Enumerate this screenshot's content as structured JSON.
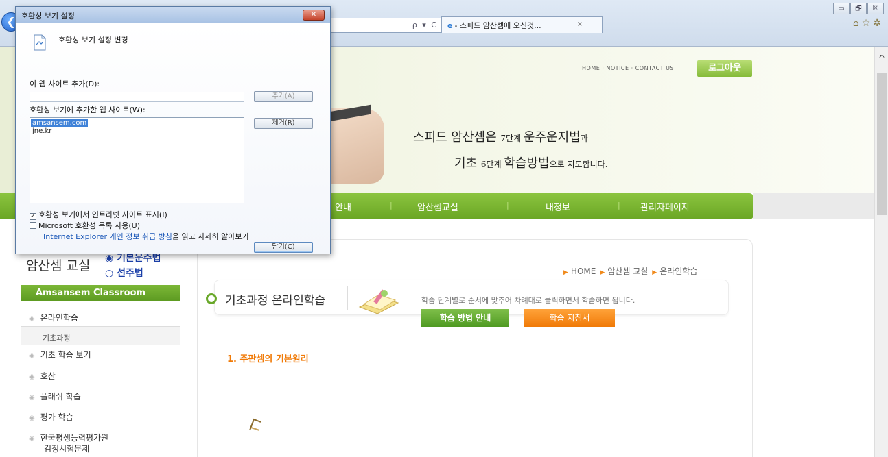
{
  "browser": {
    "tab_title": "- 스피드 암산셈에 오신것...",
    "address_tools": "ρ ▾ C",
    "tab_close": "×",
    "window_buttons": [
      "▭",
      "🗗",
      "☒"
    ],
    "toolbar_icons": [
      "home-icon",
      "favorites-star-icon",
      "tools-gear-icon"
    ]
  },
  "site": {
    "top_links": "HOME · NOTICE · CONTACT US",
    "logout_label": "로그아웃",
    "slogan_line1_a": "스피드 암산셈은 ",
    "slogan_line1_b": "7단계 ",
    "slogan_line1_c": "운주운지법",
    "slogan_line1_d": "과",
    "slogan_line2_a": "기초 ",
    "slogan_line2_b": "6단계 ",
    "slogan_line2_c": "학습방법",
    "slogan_line2_d": "으로 지도합니다.",
    "nav": [
      "안내",
      "암산셈교실",
      "내정보",
      "관리자페이지"
    ]
  },
  "sidebar": {
    "title": "암산셈 교실",
    "radio_1": "◉ 기본운주법",
    "radio_2": "○ 선주법",
    "header": "Amsansem Classroom",
    "item_online": "온라인학습",
    "sub_basic": "기초과정",
    "items": [
      "기초 학습 보기",
      "호산",
      "플래쉬 학습",
      "평가 학습",
      "한국평생능력평가원",
      "검정시험문제"
    ]
  },
  "main": {
    "breadcrumb": [
      "HOME",
      "암산셈 교실",
      "온라인학습"
    ],
    "course_title": "기초과정 온라인학습",
    "course_desc": "학습 단계별로 순서에 맞추어 차례대로 클릭하면서 학습하면 됩니다.",
    "btn_guide": "학습 방법 안내",
    "btn_guidebook": "학습 지침서",
    "section_heading": "1. 주판셈의 기본원리"
  },
  "dialog": {
    "title": "호환성 보기 설정",
    "header": "호환성 보기 설정 변경",
    "add_label": "이 웹 사이트 추가(D):",
    "add_input_value": "",
    "add_button": "추가(A)",
    "list_label": "호환성 보기에 추가한 웹 사이트(W):",
    "sites": [
      "amsansem.com",
      "jne.kr"
    ],
    "remove_button": "제거(R)",
    "check_intranet": "호환성 보기에서 인트라넷 사이트 표시(I)",
    "check_intranet_checked": true,
    "check_ms_list": "Microsoft 호환성 목록 사용(U)",
    "check_ms_list_checked": false,
    "privacy_link": "Internet Explorer 개인 정보 취급 방침",
    "privacy_suffix": "을 읽고 자세히 알아보기",
    "close_button": "닫기(C)",
    "close_x": "✕"
  },
  "scrollbar": {
    "up_arrow": "^"
  },
  "colors": {
    "nav_green": "#7ab532",
    "logout_green": "#9fcd55",
    "guide_green": "#5fa82e",
    "guidebook_orange": "#f58a14",
    "heading_orange": "#f07a07",
    "list_select_blue": "#3f82d8",
    "link_blue": "#1b58b8"
  }
}
